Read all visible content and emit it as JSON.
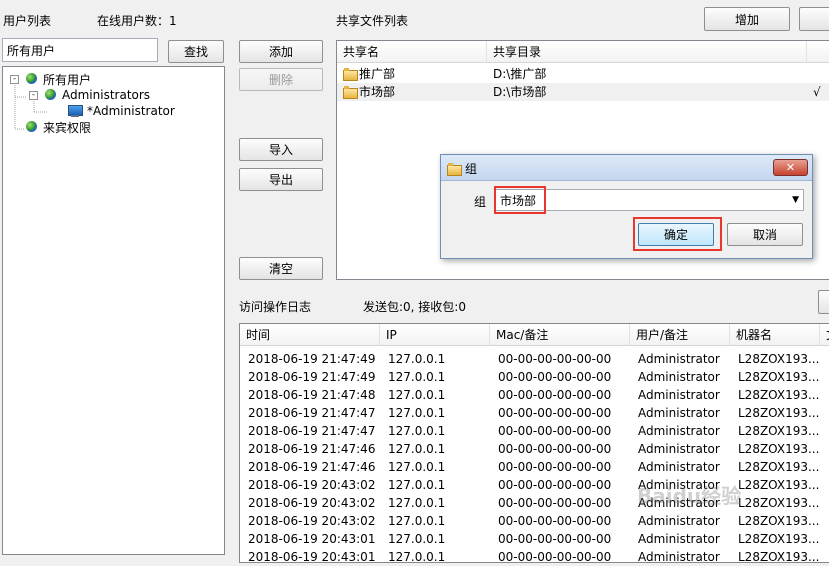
{
  "user_panel": {
    "title": "用户列表",
    "online_label": "在线用户数：1",
    "search_value": "所有用户",
    "search_button": "查找",
    "tree": [
      {
        "label": "所有用户",
        "icon": "users-globe-icon",
        "expander": "-"
      },
      {
        "label": "Administrators",
        "icon": "group-globe-icon",
        "expander": "-"
      },
      {
        "label": "*Administrator",
        "icon": "computer-user-icon",
        "expander": ""
      },
      {
        "label": "来宾权限",
        "icon": "guest-globe-icon",
        "expander": ""
      }
    ]
  },
  "middle_buttons": {
    "add": "添加",
    "delete": "删除",
    "import": "导入",
    "export": "导出",
    "clear": "清空"
  },
  "share_panel": {
    "title": "共享文件列表",
    "add_button": "增加",
    "columns": [
      "共享名",
      "共享目录"
    ],
    "rows": [
      {
        "name": "推广部",
        "dir": "D:\\推广部",
        "check": ""
      },
      {
        "name": "市场部",
        "dir": "D:\\市场部",
        "check": "√"
      }
    ]
  },
  "log_panel": {
    "title": "访问操作日志",
    "stats": "发送包:0, 接收包:0",
    "columns": [
      "时间",
      "IP",
      "Mac/备注",
      "用户/备注",
      "机器名",
      "文"
    ],
    "rows": [
      [
        "2018-06-19 21:47:49",
        "127.0.0.1",
        "00-00-00-00-00-00",
        "Administrator",
        "L28ZOX193..."
      ],
      [
        "2018-06-19 21:47:49",
        "127.0.0.1",
        "00-00-00-00-00-00",
        "Administrator",
        "L28ZOX193..."
      ],
      [
        "2018-06-19 21:47:48",
        "127.0.0.1",
        "00-00-00-00-00-00",
        "Administrator",
        "L28ZOX193..."
      ],
      [
        "2018-06-19 21:47:47",
        "127.0.0.1",
        "00-00-00-00-00-00",
        "Administrator",
        "L28ZOX193..."
      ],
      [
        "2018-06-19 21:47:47",
        "127.0.0.1",
        "00-00-00-00-00-00",
        "Administrator",
        "L28ZOX193..."
      ],
      [
        "2018-06-19 21:47:46",
        "127.0.0.1",
        "00-00-00-00-00-00",
        "Administrator",
        "L28ZOX193..."
      ],
      [
        "2018-06-19 21:47:46",
        "127.0.0.1",
        "00-00-00-00-00-00",
        "Administrator",
        "L28ZOX193..."
      ],
      [
        "2018-06-19 20:43:02",
        "127.0.0.1",
        "00-00-00-00-00-00",
        "Administrator",
        "L28ZOX193..."
      ],
      [
        "2018-06-19 20:43:02",
        "127.0.0.1",
        "00-00-00-00-00-00",
        "Administrator",
        "L28ZOX193..."
      ],
      [
        "2018-06-19 20:43:02",
        "127.0.0.1",
        "00-00-00-00-00-00",
        "Administrator",
        "L28ZOX193..."
      ],
      [
        "2018-06-19 20:43:01",
        "127.0.0.1",
        "00-00-00-00-00-00",
        "Administrator",
        "L28ZOX193..."
      ],
      [
        "2018-06-19 20:43:01",
        "127.0.0.1",
        "00-00-00-00-00-00",
        "Administrator",
        "L28ZOX193..."
      ]
    ]
  },
  "dialog": {
    "title": "组",
    "field_label": "组",
    "field_value": "市场部",
    "ok_button": "确定",
    "cancel_button": "取消",
    "close_glyph": "✕"
  },
  "watermark": "Baidu经验",
  "colors": {
    "highlight": "#e8372c",
    "panel_border": "#828790",
    "dialog_title": "#c3d6ef"
  }
}
